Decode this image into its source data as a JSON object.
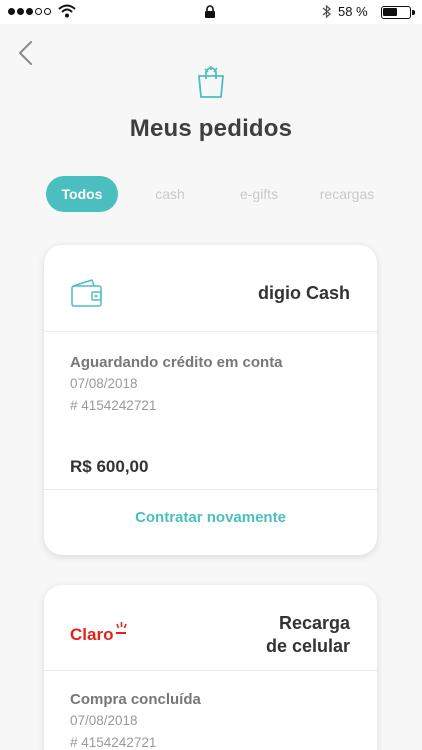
{
  "status_bar": {
    "battery": "58 %",
    "battery_level": 0.58
  },
  "header": {
    "title": "Meus pedidos"
  },
  "tabs": [
    {
      "label": "Todos",
      "active": true
    },
    {
      "label": "cash",
      "active": false
    },
    {
      "label": "e-gifts",
      "active": false
    },
    {
      "label": "recargas",
      "active": false
    }
  ],
  "orders": [
    {
      "title": "digio Cash",
      "icon": "wallet-icon",
      "status": "Aguardando crédito em conta",
      "date": "07/08/2018",
      "order_id": "# 4154242721",
      "amount": "R$ 600,00",
      "action": "Contratar novamente"
    },
    {
      "title_line1": "Recarga",
      "title_line2": "de celular",
      "logo_text": "Claro",
      "status": "Compra concluída",
      "date": "07/08/2018",
      "order_id": "# 4154242721"
    }
  ],
  "colors": {
    "accent": "#4bbfbf",
    "claro_red": "#e2231a"
  }
}
